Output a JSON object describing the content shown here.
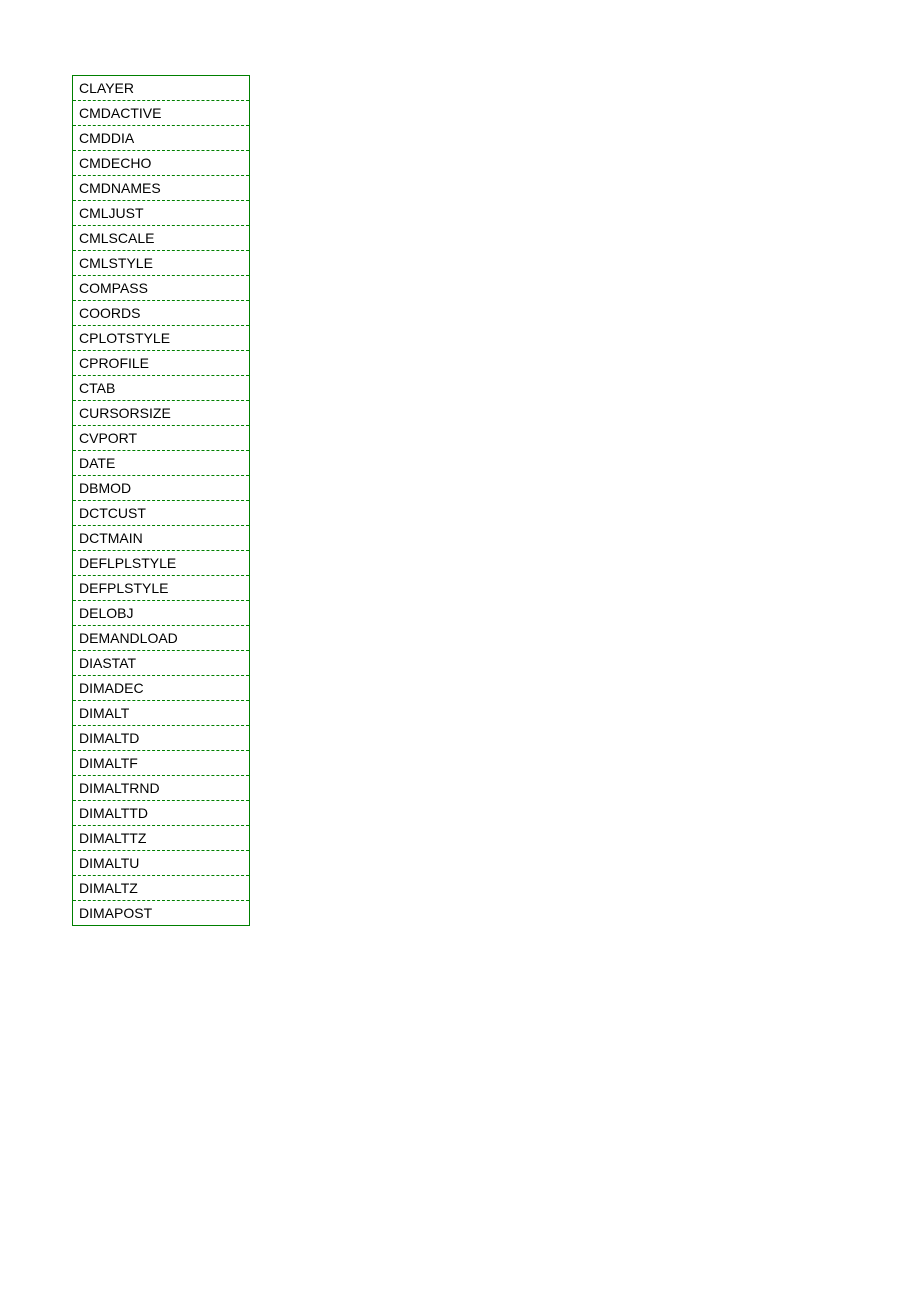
{
  "list": {
    "items": [
      "CLAYER",
      "CMDACTIVE",
      "CMDDIA",
      "CMDECHO",
      "CMDNAMES",
      "CMLJUST",
      "CMLSCALE",
      "CMLSTYLE",
      "COMPASS",
      "COORDS",
      "CPLOTSTYLE",
      "CPROFILE",
      "CTAB",
      "CURSORSIZE",
      "CVPORT",
      "DATE",
      "DBMOD",
      "DCTCUST",
      "DCTMAIN",
      "DEFLPLSTYLE",
      "DEFPLSTYLE",
      "DELOBJ",
      "DEMANDLOAD",
      "DIASTAT",
      "DIMADEC",
      "DIMALT",
      "DIMALTD",
      "DIMALTF",
      "DIMALTRND",
      "DIMALTTD",
      "DIMALTTZ",
      "DIMALTU",
      "DIMALTZ",
      "DIMAPOST"
    ]
  }
}
